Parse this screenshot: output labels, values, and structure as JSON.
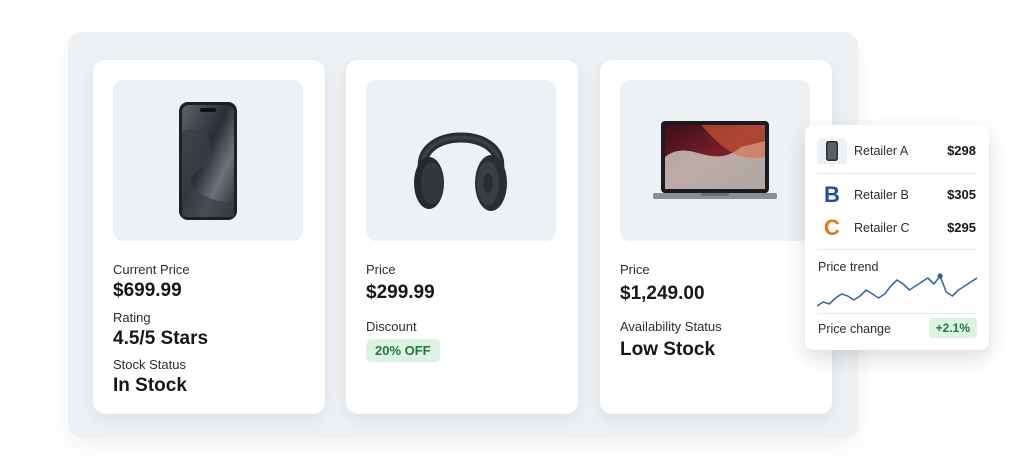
{
  "products": [
    {
      "image_icon": "smartphone-icon",
      "fields": [
        {
          "label": "Current Price",
          "value": "$699.99"
        },
        {
          "label": "Rating",
          "value": "4.5/5 Stars"
        },
        {
          "label": "Stock Status",
          "value": "In Stock"
        }
      ]
    },
    {
      "image_icon": "headphones-icon",
      "fields": [
        {
          "label": "Price",
          "value": "$299.99"
        },
        {
          "label": "Discount",
          "badge": "20% OFF"
        }
      ]
    },
    {
      "image_icon": "laptop-icon",
      "fields": [
        {
          "label": "Price",
          "value": "$1,249.00"
        },
        {
          "label": "Availability Status",
          "value": "Low Stock"
        }
      ]
    }
  ],
  "retailers": [
    {
      "name": "Retailer A",
      "price": "$298",
      "logo_icon": "smartphone-thumbnail-icon"
    },
    {
      "name": "Retailer B",
      "price": "$305",
      "logo_letter": "B",
      "logo_color": "#1f4fa3"
    },
    {
      "name": "Retailer C",
      "price": "$295",
      "logo_letter": "C",
      "logo_color": "#e07a1f"
    }
  ],
  "trend": {
    "label": "Price trend",
    "values": [
      3,
      5,
      4,
      7,
      9,
      8,
      6,
      8,
      11,
      9,
      7,
      9,
      13,
      16,
      14,
      11,
      13,
      15,
      17,
      14,
      18,
      10,
      8,
      11,
      13,
      15,
      17
    ],
    "highlight_index": 20,
    "line_color": "#3a6a9e",
    "point_color": "#2f5f92"
  },
  "change": {
    "label": "Price change",
    "value": "+2.1%"
  },
  "colors": {
    "accent_green_bg": "#dcf2e2",
    "accent_green_text": "#1f7a3c",
    "panel_bg": "#eef1f3"
  }
}
